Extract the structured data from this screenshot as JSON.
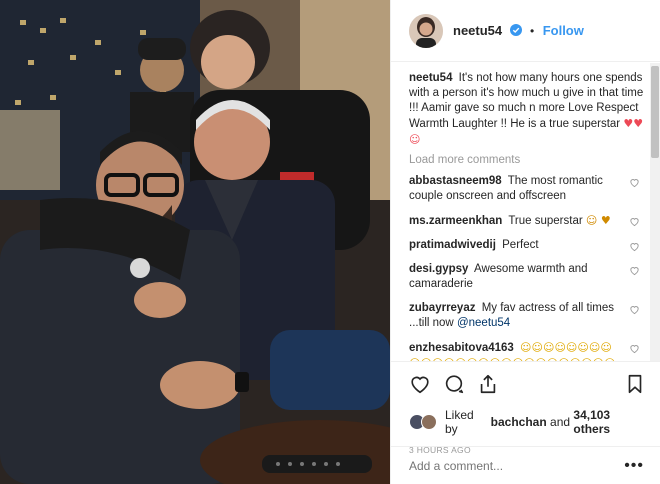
{
  "header": {
    "username": "neetu54",
    "verified": true,
    "separator": "•",
    "follow_label": "Follow"
  },
  "caption": {
    "username": "neetu54",
    "text": "It's not how many hours one spends with a person it's how much u give in that time !!! Aamir gave so much n more Love Respect Warmth Laughter !! He is a true superstar",
    "emojis": "♥♥☺"
  },
  "load_more": "Load more comments",
  "comments": [
    {
      "username": "abbastasneem98",
      "text": "The most romantic couple onscreen and offscreen"
    },
    {
      "username": "ms.zarmeenkhan",
      "text": "True superstar",
      "emojis": "☺ ♥"
    },
    {
      "username": "pratimadwivedij",
      "text": "Perfect"
    },
    {
      "username": "desi.gypsy",
      "text": "Awesome warmth and camaraderie"
    },
    {
      "username": "zubayrreyaz",
      "text": "My fav actress of all times ...till now",
      "mention": "@neetu54"
    },
    {
      "username": "enzhesabitova4163",
      "text": "",
      "emojis": "☺☺☺☺☺☺☺☺☺☺☺☺☺☺☺☺☺☺☺☺☺☺☺☺☺☺☺☺"
    }
  ],
  "likes": {
    "prefix": "Liked by",
    "user": "bachchan",
    "middle": "and",
    "count": "34,103 others"
  },
  "time_ago": "3 HOURS AGO",
  "add_comment": {
    "placeholder": "Add a comment..."
  },
  "more_label": "•••",
  "icons": {
    "like": "heart-outline-icon",
    "comment": "comment-bubble-icon",
    "share": "share-icon",
    "save": "bookmark-icon",
    "verified": "verified-badge-icon"
  },
  "colors": {
    "accent": "#3897f0",
    "text": "#262626",
    "muted": "#999999",
    "heart": "#ed4956"
  }
}
